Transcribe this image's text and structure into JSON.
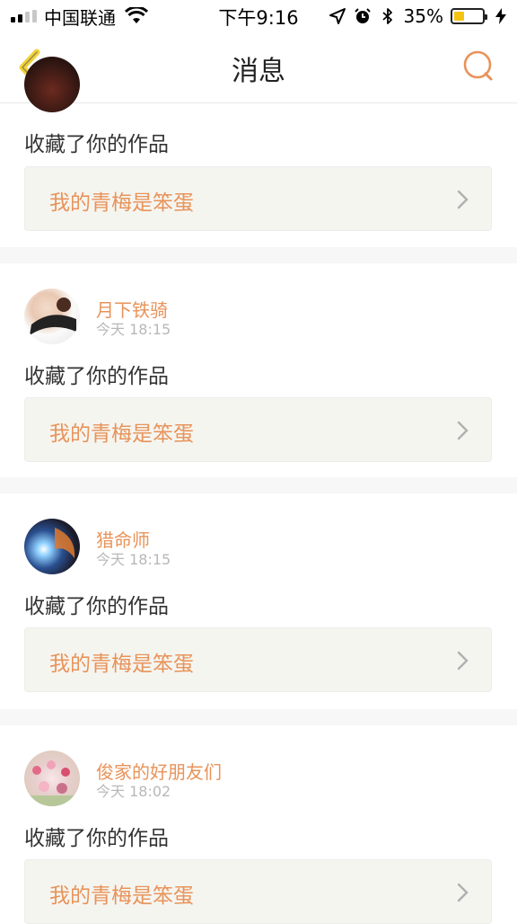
{
  "status_bar": {
    "carrier": "中国联通",
    "time": "下午9:16",
    "battery_percent_text": "35%",
    "battery_level": 0.35,
    "icons": [
      "signal-icon",
      "wifi-icon",
      "location-arrow-icon",
      "alarm-icon",
      "bluetooth-icon",
      "battery-icon",
      "charging-icon"
    ]
  },
  "nav": {
    "title": "消息",
    "back_icon": "chevron-left-icon",
    "search_icon": "search-icon",
    "accent_color": "#e8935a",
    "back_color": "#f2d23a"
  },
  "messages": [
    {
      "user": "",
      "time": "",
      "action": "收藏了你的作品",
      "work_title": "我的青梅是笨蛋"
    },
    {
      "user": "月下铁骑",
      "time": "今天 18:15",
      "action": "收藏了你的作品",
      "work_title": "我的青梅是笨蛋"
    },
    {
      "user": "猎命师",
      "time": "今天 18:15",
      "action": "收藏了你的作品",
      "work_title": "我的青梅是笨蛋"
    },
    {
      "user": "俊家的好朋友们",
      "time": "今天 18:02",
      "action": "收藏了你的作品",
      "work_title": "我的青梅是笨蛋"
    }
  ]
}
